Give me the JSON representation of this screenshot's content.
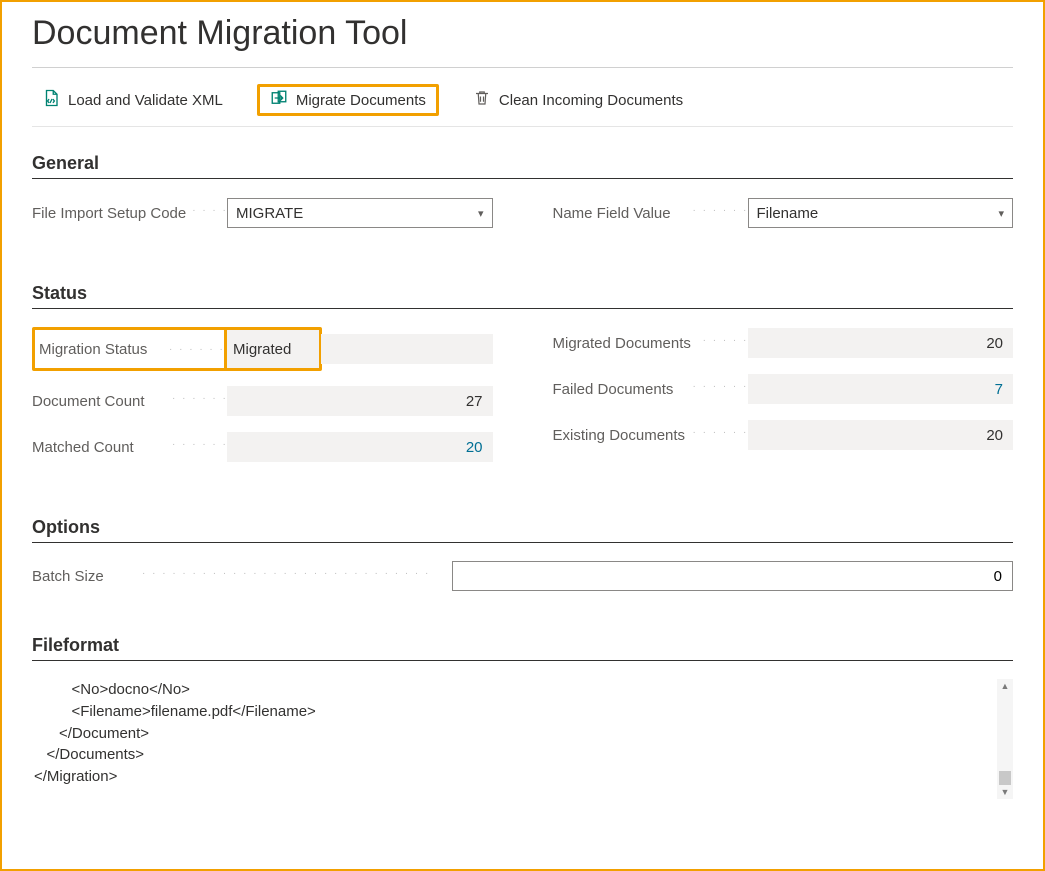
{
  "title": "Document Migration Tool",
  "actions": {
    "load_validate": "Load and Validate XML",
    "migrate": "Migrate Documents",
    "clean": "Clean Incoming Documents"
  },
  "sections": {
    "general": "General",
    "status": "Status",
    "options": "Options",
    "fileformat": "Fileformat"
  },
  "general": {
    "file_import_label": "File Import Setup Code",
    "file_import_value": "MIGRATE",
    "name_field_label": "Name Field Value",
    "name_field_value": "Filename"
  },
  "status": {
    "migration_status_label": "Migration Status",
    "migration_status_value": "Migrated",
    "document_count_label": "Document Count",
    "document_count_value": "27",
    "matched_count_label": "Matched Count",
    "matched_count_value": "20",
    "migrated_docs_label": "Migrated Documents",
    "migrated_docs_value": "20",
    "failed_docs_label": "Failed Documents",
    "failed_docs_value": "7",
    "existing_docs_label": "Existing Documents",
    "existing_docs_value": "20"
  },
  "options": {
    "batch_size_label": "Batch Size",
    "batch_size_value": "0"
  },
  "fileformat": {
    "content": "         <No>docno</No>\n         <Filename>filename.pdf</Filename>\n      </Document>\n   </Documents>\n</Migration>"
  }
}
